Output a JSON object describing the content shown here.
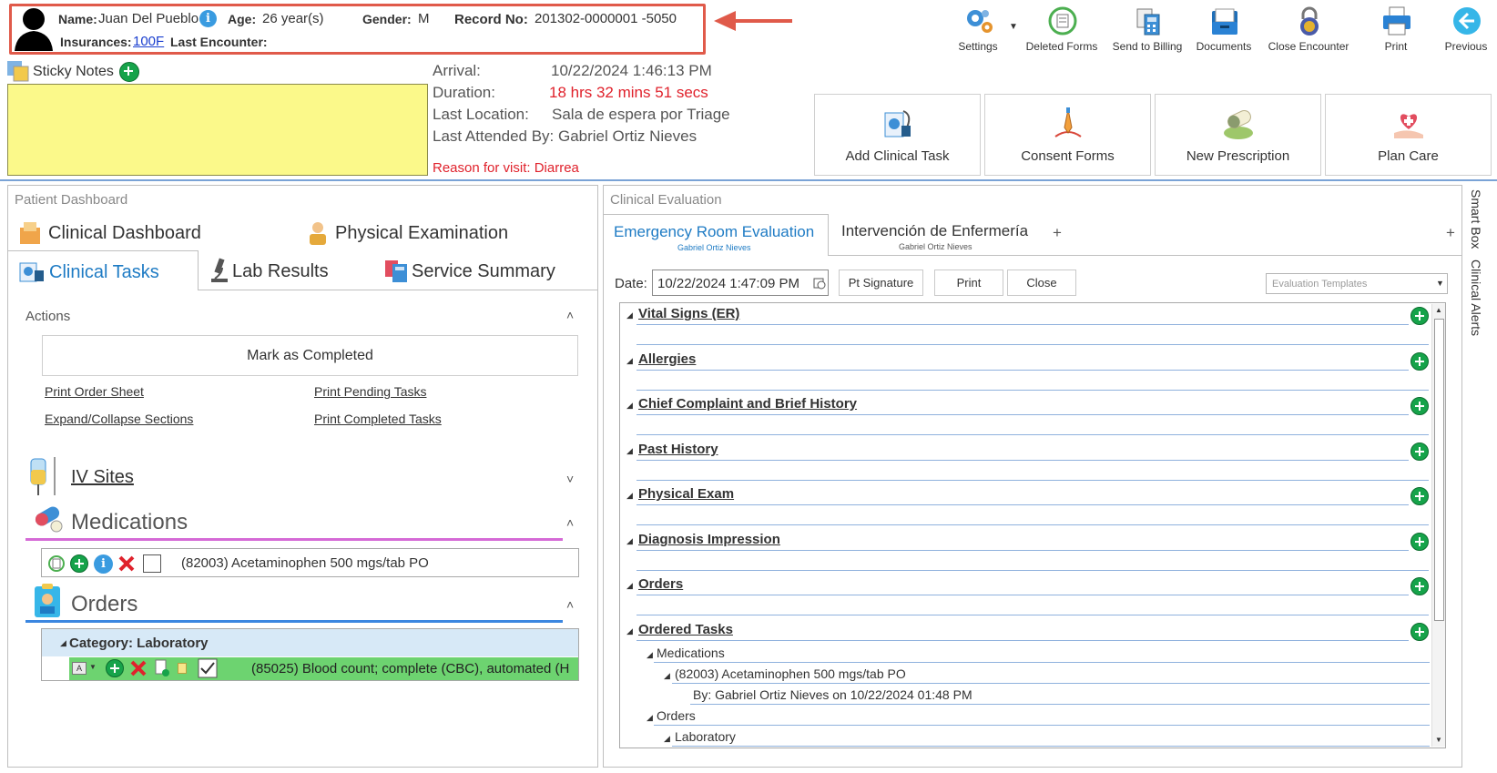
{
  "patient": {
    "name_label": "Name:",
    "name": "Juan Del Pueblo",
    "age_label": "Age:",
    "age": "26 year(s)",
    "gender_label": "Gender:",
    "gender": "M",
    "record_label": "Record No:",
    "record_no": "201302-0000001 -5050",
    "insurances_label": "Insurances:",
    "insurance": "100F",
    "last_encounter_label": "Last Encounter:"
  },
  "toolbar": {
    "settings": "Settings",
    "deleted_forms": "Deleted Forms",
    "send_to_billing": "Send to Billing",
    "documents": "Documents",
    "close_encounter": "Close Encounter",
    "print": "Print",
    "previous": "Previous"
  },
  "sticky": {
    "label": "Sticky Notes"
  },
  "encounter": {
    "arrival_label": "Arrival:",
    "arrival": "10/22/2024 1:46:13 PM",
    "duration_label": "Duration:",
    "duration": "18 hrs 32 mins 51 secs",
    "location_label": "Last Location:",
    "location": "Sala de espera por Triage",
    "attended": "Last Attended By: Gabriel Ortiz Nieves",
    "reason": "Reason for visit: Diarrea"
  },
  "actions_cards": {
    "add_task": "Add Clinical Task",
    "consent": "Consent Forms",
    "prescription": "New Prescription",
    "plan_care": "Plan Care"
  },
  "left": {
    "title": "Patient Dashboard",
    "tabs": {
      "clinical_dashboard": "Clinical Dashboard",
      "physical_exam": "Physical Examination",
      "clinical_tasks": "Clinical Tasks",
      "lab_results": "Lab Results",
      "service_summary": "Service Summary"
    },
    "actions_label": "Actions",
    "mark_completed": "Mark as Completed",
    "links": {
      "print_order_sheet": "Print Order Sheet",
      "print_pending": "Print Pending Tasks",
      "expand_collapse": "Expand/Collapse Sections",
      "print_completed": "Print Completed Tasks"
    },
    "iv_sites": "IV Sites",
    "medications": "Medications",
    "medication_item": "(82003) Acetaminophen 500 mgs/tab PO",
    "orders": "Orders",
    "category": "Category: Laboratory",
    "order_item": "(85025) Blood count; complete (CBC), automated (H"
  },
  "right": {
    "title": "Clinical Evaluation",
    "tab1": "Emergency Room Evaluation",
    "tab1_sub": "Gabriel Ortiz Nieves",
    "tab2": "Intervención de Enfermería",
    "tab2_sub": "Gabriel Ortiz Nieves",
    "add_tab": "+",
    "date_label": "Date:",
    "date_value": "10/22/2024 1:47:09 PM",
    "pt_signature": "Pt Signature",
    "print": "Print",
    "close": "Close",
    "templates_placeholder": "Evaluation Templates",
    "sections": [
      "Vital Signs (ER)",
      "Allergies",
      "Chief Complaint and Brief History",
      "Past History",
      "Physical Exam",
      "Diagnosis Impression",
      "Orders",
      "Ordered Tasks"
    ],
    "tree": {
      "medications": "Medications",
      "med_item": "(82003) Acetaminophen 500 mgs/tab PO",
      "med_by": "By: Gabriel Ortiz Nieves on 10/22/2024 01:48 PM",
      "orders": "Orders",
      "laboratory": "Laboratory"
    }
  },
  "side": {
    "smart_box": "Smart Box",
    "clinical_alerts": "Clinical Alerts"
  }
}
